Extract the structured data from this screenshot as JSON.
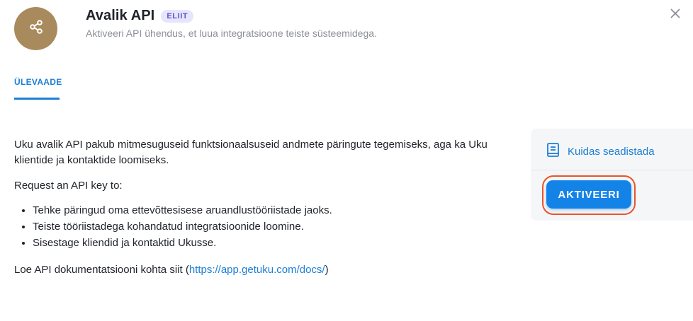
{
  "header": {
    "avatar_icon": "share-icon",
    "title": "Avalik API",
    "badge": "ELIIT",
    "subtitle": "Aktiveeri API ühendus, et luua integratsioone teiste süsteemidega.",
    "close_icon": "close-icon"
  },
  "tabs": [
    {
      "label": "ÜLEVAADE",
      "active": true
    }
  ],
  "content": {
    "intro": "Uku avalik API pakub mitmesuguseid funktsionaalsuseid andmete päringute tegemiseks, aga ka Uku klientide ja kontaktide loomiseks.",
    "request": "Request an API key to:",
    "bullets": [
      "Tehke päringud oma ettevõttesisese aruandlustööriistade jaoks.",
      "Teiste tööriistadega kohandatud integratsioonide loomine.",
      "Sisestage kliendid ja kontaktid Ukusse."
    ],
    "docs_prefix": "Loe API dokumentatsiooni kohta siit (",
    "docs_link": "https://app.getuku.com/docs/",
    "docs_suffix": ")"
  },
  "sidebar": {
    "guide_icon": "book-icon",
    "guide_label": "Kuidas seadistada",
    "activate_label": "AKTIVEERI"
  },
  "colors": {
    "accent": "#1b7fd6",
    "button": "#1483e8",
    "highlight_ring": "#e8552b",
    "avatar": "#a88a5c",
    "badge_bg": "#e6e5fb",
    "badge_text": "#5b57c9"
  }
}
